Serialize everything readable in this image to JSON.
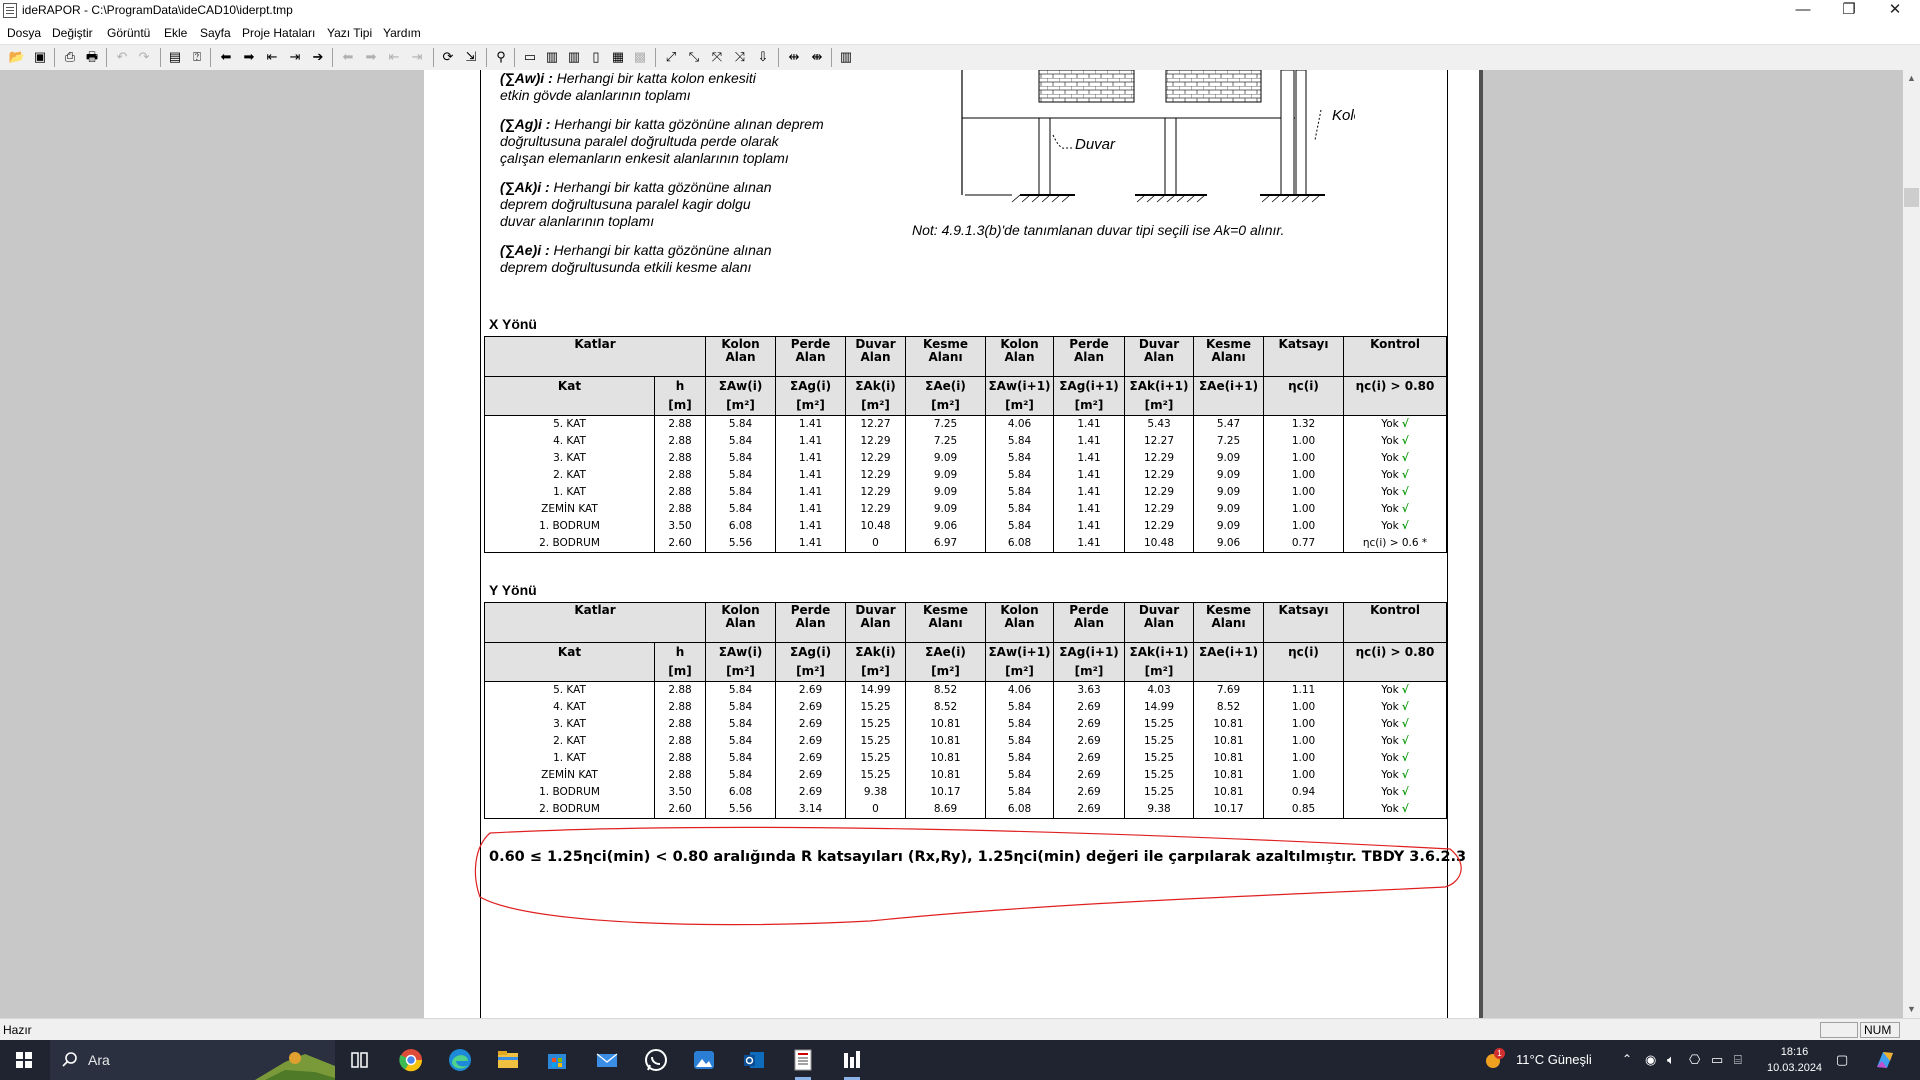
{
  "window": {
    "title": "ideRAPOR - C:\\ProgramData\\ideCAD10\\iderpt.tmp",
    "minimize": "—",
    "restore": "❐",
    "close": "✕"
  },
  "menu": [
    "Dosya",
    "Değiştir",
    "Görüntü",
    "Ekle",
    "Sayfa",
    "Proje Hataları",
    "Yazı Tipi",
    "Yardım"
  ],
  "definitions": [
    {
      "symbol": "(∑Aw)i :",
      "text1": " Herhangi bir katta kolon enkesiti",
      "text2": "etkin gövde alanlarının toplamı",
      "text3": ""
    },
    {
      "symbol": "(∑Ag)i :",
      "text1": " Herhangi bir katta gözönüne alınan deprem",
      "text2": "doğrultusuna paralel doğrultuda perde olarak",
      "text3": "çalışan elemanların enkesit alanlarının toplamı"
    },
    {
      "symbol": "(∑Ak)i :",
      "text1": " Herhangi bir katta gözönüne alınan",
      "text2": "deprem  doğrultusuna paralel kagir dolgu",
      "text3": "duvar alanlarının toplamı"
    },
    {
      "symbol": "(∑Ae)i :",
      "text1": " Herhangi bir katta gözönüne alınan",
      "text2": "deprem doğrultusunda etkili kesme alanı",
      "text3": ""
    }
  ],
  "figure": {
    "duvar_label": "Duvar",
    "kolon_label": "Kolon"
  },
  "note": "Not: 4.9.1.3(b)'de tanımlanan duvar tipi seçili ise Ak=0 alınır.",
  "header": {
    "katlar": "Katlar",
    "kolon1": "Kolon",
    "alan1": "Alan",
    "perde1": "Perde",
    "alan2": "Alan",
    "duvar1": "Duvar",
    "alan3": "Alan",
    "kesme1": "Kesme",
    "alani1": "Alanı",
    "kolon2": "Kolon",
    "alan4": "Alan",
    "perde2": "Perde",
    "alan5": "Alan",
    "duvar2": "Duvar",
    "alan6": "Alan",
    "kesme2": "Kesme",
    "alani2": "Alanı",
    "katsayi": "Katsayı",
    "kontrol": "Kontrol",
    "kat": "Kat",
    "h": "h",
    "h_unit": "[m]",
    "aw": "ΣAw(i)",
    "ag": "ΣAg(i)",
    "ak": "ΣAk(i)",
    "ae": "ΣAe(i)",
    "aw1": "ΣAw(i+1)",
    "ag1": "ΣAg(i+1)",
    "ak1": "ΣAk(i+1)",
    "ae1": "ΣAe(i+1)",
    "m2": "[m²]",
    "eta": "ηc(i)",
    "eta_ctrl": "ηc(i) > 0.80"
  },
  "x_table": {
    "title": "X Yönü",
    "rows": [
      [
        "5. KAT",
        "2.88",
        "5.84",
        "1.41",
        "12.27",
        "7.25",
        "4.06",
        "1.41",
        "5.43",
        "5.47",
        "1.32",
        "Yok",
        "√"
      ],
      [
        "4. KAT",
        "2.88",
        "5.84",
        "1.41",
        "12.29",
        "7.25",
        "5.84",
        "1.41",
        "12.27",
        "7.25",
        "1.00",
        "Yok",
        "√"
      ],
      [
        "3. KAT",
        "2.88",
        "5.84",
        "1.41",
        "12.29",
        "9.09",
        "5.84",
        "1.41",
        "12.29",
        "9.09",
        "1.00",
        "Yok",
        "√"
      ],
      [
        "2. KAT",
        "2.88",
        "5.84",
        "1.41",
        "12.29",
        "9.09",
        "5.84",
        "1.41",
        "12.29",
        "9.09",
        "1.00",
        "Yok",
        "√"
      ],
      [
        "1. KAT",
        "2.88",
        "5.84",
        "1.41",
        "12.29",
        "9.09",
        "5.84",
        "1.41",
        "12.29",
        "9.09",
        "1.00",
        "Yok",
        "√"
      ],
      [
        "ZEMİN KAT",
        "2.88",
        "5.84",
        "1.41",
        "12.29",
        "9.09",
        "5.84",
        "1.41",
        "12.29",
        "9.09",
        "1.00",
        "Yok",
        "√"
      ],
      [
        "1. BODRUM",
        "3.50",
        "6.08",
        "1.41",
        "10.48",
        "9.06",
        "5.84",
        "1.41",
        "12.29",
        "9.09",
        "1.00",
        "Yok",
        "√"
      ],
      [
        "2. BODRUM",
        "2.60",
        "5.56",
        "1.41",
        "0",
        "6.97",
        "6.08",
        "1.41",
        "10.48",
        "9.06",
        "0.77",
        "ηc(i) > 0.6 *",
        ""
      ]
    ]
  },
  "y_table": {
    "title": "Y Yönü",
    "rows": [
      [
        "5. KAT",
        "2.88",
        "5.84",
        "2.69",
        "14.99",
        "8.52",
        "4.06",
        "3.63",
        "4.03",
        "7.69",
        "1.11",
        "Yok",
        "√"
      ],
      [
        "4. KAT",
        "2.88",
        "5.84",
        "2.69",
        "15.25",
        "8.52",
        "5.84",
        "2.69",
        "14.99",
        "8.52",
        "1.00",
        "Yok",
        "√"
      ],
      [
        "3. KAT",
        "2.88",
        "5.84",
        "2.69",
        "15.25",
        "10.81",
        "5.84",
        "2.69",
        "15.25",
        "10.81",
        "1.00",
        "Yok",
        "√"
      ],
      [
        "2. KAT",
        "2.88",
        "5.84",
        "2.69",
        "15.25",
        "10.81",
        "5.84",
        "2.69",
        "15.25",
        "10.81",
        "1.00",
        "Yok",
        "√"
      ],
      [
        "1. KAT",
        "2.88",
        "5.84",
        "2.69",
        "15.25",
        "10.81",
        "5.84",
        "2.69",
        "15.25",
        "10.81",
        "1.00",
        "Yok",
        "√"
      ],
      [
        "ZEMİN KAT",
        "2.88",
        "5.84",
        "2.69",
        "15.25",
        "10.81",
        "5.84",
        "2.69",
        "15.25",
        "10.81",
        "1.00",
        "Yok",
        "√"
      ],
      [
        "1. BODRUM",
        "3.50",
        "6.08",
        "2.69",
        "9.38",
        "10.17",
        "5.84",
        "2.69",
        "15.25",
        "10.81",
        "0.94",
        "Yok",
        "√"
      ],
      [
        "2. BODRUM",
        "2.60",
        "5.56",
        "3.14",
        "0",
        "8.69",
        "6.08",
        "2.69",
        "9.38",
        "10.17",
        "0.85",
        "Yok",
        "√"
      ]
    ]
  },
  "footnote": "0.60 ≤ 1.25ηci(min) < 0.80 aralığında R katsayıları (Rx,Ry), 1.25ηci(min) değeri ile çarpılarak azaltılmıştır. TBDY 3.6.2.3",
  "status": {
    "text": "Hazır",
    "num": "NUM"
  },
  "taskbar": {
    "search_placeholder": "Ara",
    "weather": "11°C  Güneşli",
    "time": "18:16",
    "date": "10.03.2024",
    "badge": "1"
  },
  "colors": {
    "check": "#0a9a0a",
    "annotation": "#e02020",
    "taskbar": "#1f2430"
  }
}
